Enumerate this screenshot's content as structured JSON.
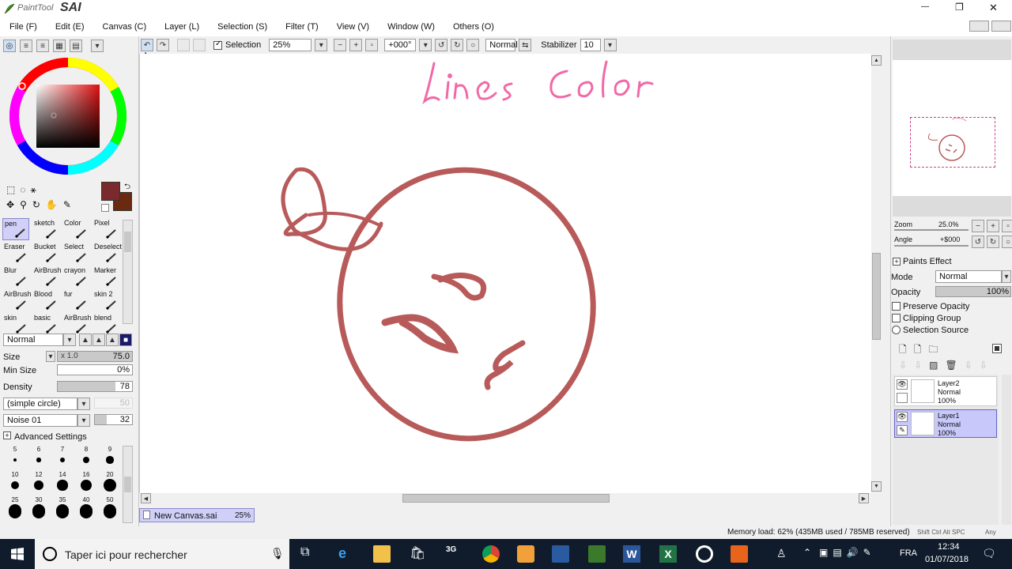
{
  "app": {
    "logo_text": "PaintTool",
    "logo_sai": "SAI",
    "window_controls": {
      "minimize": "—",
      "restore": "❐",
      "close": "✕"
    }
  },
  "menu": [
    "File (F)",
    "Edit (E)",
    "Canvas (C)",
    "Layer (L)",
    "Selection (S)",
    "Filter (T)",
    "View (V)",
    "Window (W)",
    "Others (O)"
  ],
  "toolbar": {
    "selection_label": "Selection",
    "selection_checked": true,
    "zoom": "25%",
    "rotation": "+000°",
    "blend_mode": "Normal",
    "stabilizer_label": "Stabilizer",
    "stabilizer_value": "10"
  },
  "colors": {
    "primary": "#7a2a2c",
    "secondary": "#6b2a10",
    "line_color": "#b85a5a",
    "pink_text": "#f06aa8"
  },
  "tools": {
    "brushes": [
      [
        "pen",
        "sketch",
        "Color",
        "Pixel"
      ],
      [
        "Eraser",
        "Bucket",
        "Select",
        "Deselect"
      ],
      [
        "Blur",
        "AirBrush",
        "crayon",
        "Marker"
      ],
      [
        "AirBrush",
        "Blood",
        "fur",
        "skin 2"
      ],
      [
        "skin",
        "basic",
        "AirBrush",
        "blend"
      ]
    ],
    "blend_mode": "Normal",
    "size_label": "Size",
    "size_mult": "x 1.0",
    "size_value": "75.0",
    "min_size_label": "Min Size",
    "min_size_value": "0%",
    "density_label": "Density",
    "density_value": "78",
    "shape": "(simple circle)",
    "shape_value": "50",
    "texture": "Noise 01",
    "texture_value": "32",
    "advanced_label": "Advanced Settings",
    "brush_sizes_row1": [
      "5",
      "6",
      "7",
      "8",
      "9"
    ],
    "brush_sizes_row2": [
      "10",
      "12",
      "14",
      "16",
      "20"
    ],
    "brush_sizes_row3": [
      "25",
      "30",
      "35",
      "40",
      "50"
    ]
  },
  "canvas": {
    "text": "lines Color",
    "tab_name": "New Canvas.sai",
    "tab_zoom": "25%"
  },
  "navigator": {
    "zoom_label": "Zoom",
    "zoom_value": "25.0%",
    "angle_label": "Angle",
    "angle_value": "+$000"
  },
  "layers_panel": {
    "paints_effect": "Paints Effect",
    "mode_label": "Mode",
    "mode_value": "Normal",
    "opacity_label": "Opacity",
    "opacity_value": "100%",
    "preserve_opacity": "Preserve Opacity",
    "clipping_group": "Clipping Group",
    "selection_source": "Selection Source",
    "layers": [
      {
        "name": "Layer2",
        "mode": "Normal",
        "opacity": "100%",
        "selected": false
      },
      {
        "name": "Layer1",
        "mode": "Normal",
        "opacity": "100%",
        "selected": true
      }
    ]
  },
  "status": {
    "memory": "Memory load: 62% (435MB used / 785MB reserved)",
    "keys": "Shift Ctrl Alt SPC",
    "any": "Any"
  },
  "taskbar": {
    "search_placeholder": "Taper ici pour rechercher",
    "language": "FRA",
    "time": "12:34",
    "date": "01/07/2018"
  }
}
